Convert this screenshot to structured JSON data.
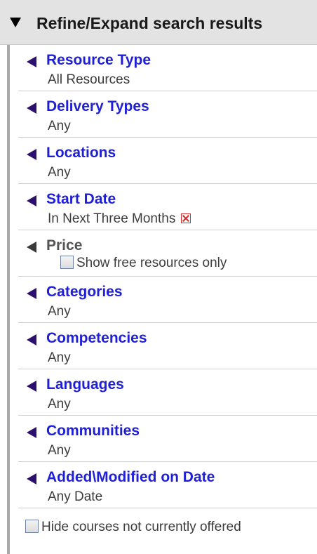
{
  "panel": {
    "title": "Refine/Expand search results",
    "sections": [
      {
        "label": "Resource Type",
        "value": "All Resources"
      },
      {
        "label": "Delivery Types",
        "value": "Any"
      },
      {
        "label": "Locations",
        "value": "Any"
      },
      {
        "label": "Start Date",
        "value": "In Next Three Months"
      },
      {
        "label": "Price",
        "checkbox_label": "Show free resources only",
        "checked": false
      },
      {
        "label": "Categories",
        "value": "Any"
      },
      {
        "label": "Competencies",
        "value": "Any"
      },
      {
        "label": "Languages",
        "value": "Any"
      },
      {
        "label": "Communities",
        "value": "Any"
      },
      {
        "label": "Added\\Modified on Date",
        "value": "Any Date"
      }
    ],
    "footer_checkbox": {
      "label": "Hide courses not currently offered",
      "checked": false
    }
  },
  "icons": {
    "header": "collapse-triangle-down-icon",
    "section": "expand-triangle-left-icon",
    "remove": "remove-filter-x-icon",
    "checkbox": "checkbox-unchecked"
  },
  "colors": {
    "link": "#1f1fd6",
    "arrow": "#2d0f6e",
    "remove": "#d62b2b",
    "header_bg": "#e3e3e3"
  }
}
